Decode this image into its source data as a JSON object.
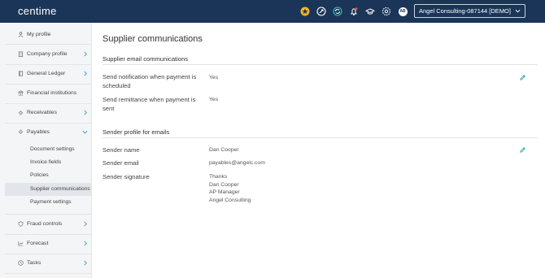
{
  "header": {
    "logo_text": "centime",
    "icons": [
      "star-badge-icon",
      "rocket-icon",
      "sync-icon",
      "bell-icon",
      "graduation-cap-icon",
      "gear-icon",
      "user-avatar"
    ],
    "avatar_initials": "AB",
    "company": "Angel Consulting-087144 [DEMO]",
    "colors": {
      "topbar": "#1a3558",
      "star_badge": "#f0b429",
      "notification_dot": "#e74c3c",
      "accent": "#31c3b6"
    }
  },
  "sidebar": {
    "items": [
      {
        "label": "My profile",
        "icon": "person-icon"
      },
      {
        "label": "Company profile",
        "icon": "building-icon"
      },
      {
        "label": "General Ledger",
        "icon": "book-icon"
      },
      {
        "label": "Financial institutions",
        "icon": "bank-icon"
      },
      {
        "label": "Receivables",
        "icon": "receivables-icon"
      },
      {
        "label": "Payables",
        "icon": "payables-icon"
      },
      {
        "label": "Fraud controls",
        "icon": "shield-icon"
      },
      {
        "label": "Forecast",
        "icon": "chart-icon"
      },
      {
        "label": "Tasks",
        "icon": "clock-icon"
      }
    ],
    "payables_subitems": [
      "Document settings",
      "Invoice fields",
      "Policies",
      "Supplier communications",
      "Payment settings"
    ],
    "active_subitem": "Supplier communications"
  },
  "main": {
    "title": "Supplier communications",
    "email_section": {
      "title": "Supplier email communications",
      "rows": [
        {
          "label": "Send notification when payment is scheduled",
          "value": "Yes"
        },
        {
          "label": "Send remittance when payment is sent",
          "value": "Yes"
        }
      ]
    },
    "sender_section": {
      "title": "Sender profile for emails",
      "name_label": "Sender name",
      "name_value": "Dan Cooper",
      "email_label": "Sender email",
      "email_value": "payables@angelc.com",
      "signature_label": "Sender signature",
      "signature_lines": [
        "Thanks",
        "Dan Cooper",
        "AP Manager",
        "Angel Consulting"
      ]
    }
  }
}
